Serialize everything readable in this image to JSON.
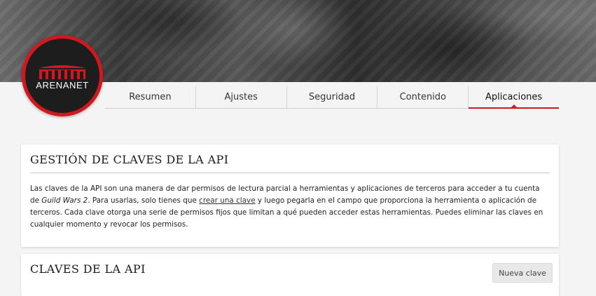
{
  "brand": {
    "logo_text": "ARENANET",
    "accent_color": "#d3171f"
  },
  "tabs": [
    {
      "label": "Resumen",
      "active": false
    },
    {
      "label": "Ajustes",
      "active": false
    },
    {
      "label": "Seguridad",
      "active": false
    },
    {
      "label": "Contenido",
      "active": false
    },
    {
      "label": "Aplicaciones",
      "active": true
    }
  ],
  "api_management": {
    "title": "GESTIÓN DE CLAVES DE LA API",
    "paragraph": {
      "part1": "Las claves de la API son una manera de dar permisos de lectura parcial a herramientas y aplicaciones de terceros para acceder a tu cuenta de ",
      "game_name": "Guild Wars 2",
      "part2": ". Para usarlas, solo tienes que ",
      "link_text": "crear una clave",
      "part3": " y luego pegarla en el campo que proporciona la herramienta o aplicación de terceros. Cada clave otorga una serie de permisos fijos que limitan a qué pueden acceder estas herramientas. Puedes eliminar las claves en cualquier momento y revocar los permisos."
    }
  },
  "api_keys": {
    "title": "CLAVES DE LA API",
    "new_key_button": "Nueva clave"
  }
}
